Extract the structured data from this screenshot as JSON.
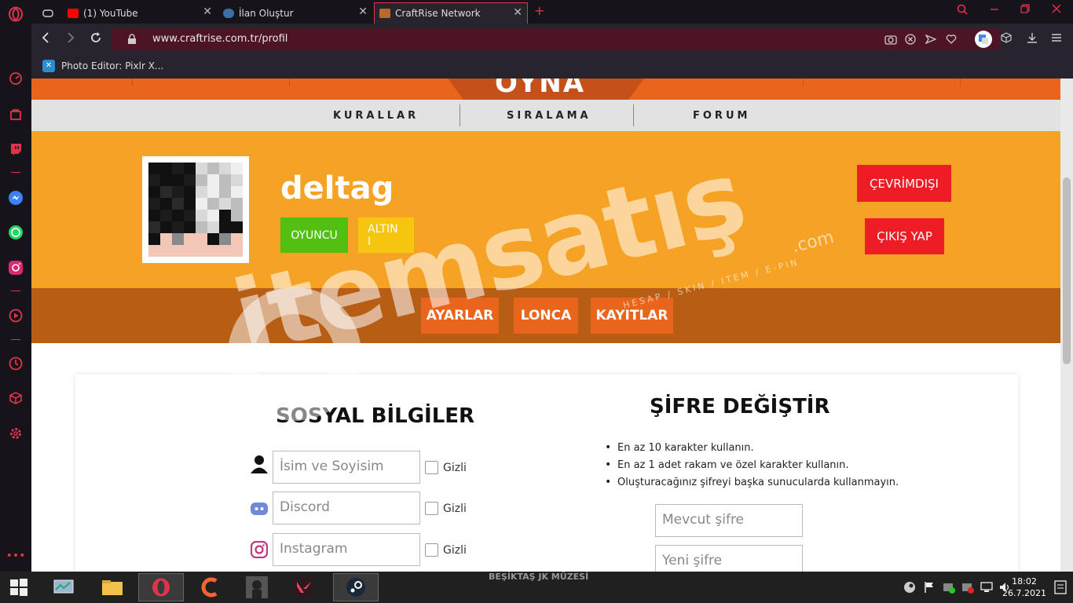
{
  "browser": {
    "tabs": [
      {
        "title": "(1) YouTube",
        "icon": "youtube-icon"
      },
      {
        "title": "İlan Oluştur",
        "icon": "itemsatis-icon"
      },
      {
        "title": "CraftRise Network",
        "icon": "craftrise-icon",
        "active": true
      }
    ],
    "new_tab_label": "+",
    "url": "www.craftrise.com.tr/profil",
    "bookmark": "Photo Editor: Pixlr X..."
  },
  "site": {
    "play_label": "OYNA",
    "menu": [
      "KURALLAR",
      "SIRALAMA",
      "FORUM"
    ],
    "username": "deltag",
    "ranks": [
      {
        "label": "OYUNCU",
        "color": "#52c010"
      },
      {
        "label": "ALTIN I",
        "color": "#f6c50f"
      }
    ],
    "status_button": "ÇEVRİMDIŞI",
    "logout_button": "ÇIKIŞ YAP",
    "subnav": [
      "AYARLAR",
      "LONCA",
      "KAYITLAR"
    ],
    "social": {
      "title": "SOSYAL BİLGİLER",
      "fields": [
        {
          "placeholder": "İsim ve Soyisim",
          "icon": "user-icon",
          "hidden_label": "Gizli"
        },
        {
          "placeholder": "Discord",
          "icon": "discord-icon",
          "hidden_label": "Gizli"
        },
        {
          "placeholder": "Instagram",
          "icon": "instagram-icon",
          "hidden_label": "Gizli"
        }
      ]
    },
    "password": {
      "title": "ŞİFRE DEĞİŞTİR",
      "rules": [
        "En az 10 karakter kullanın.",
        "En az 1 adet rakam ve özel karakter kullanın.",
        "Oluşturacağınız şifreyi başka sunucularda kullanmayın."
      ],
      "current_placeholder": "Mevcut şifre",
      "new_placeholder": "Yeni şifre"
    }
  },
  "watermark": {
    "text": "itemsatış",
    "suffix": ".com",
    "tagline": "HESAP / SKIN / ITEM / E-PIN"
  },
  "taskbar": {
    "center_text": "BEŞİKTAŞ JK MÜZESİ",
    "time": "18:02",
    "date": "26.7.2021"
  },
  "colors": {
    "orange": "#f6a225",
    "dark_orange": "#b75d14",
    "accent_orange": "#e9651b",
    "red": "#ee1c25",
    "opera_red": "#e0334b"
  }
}
